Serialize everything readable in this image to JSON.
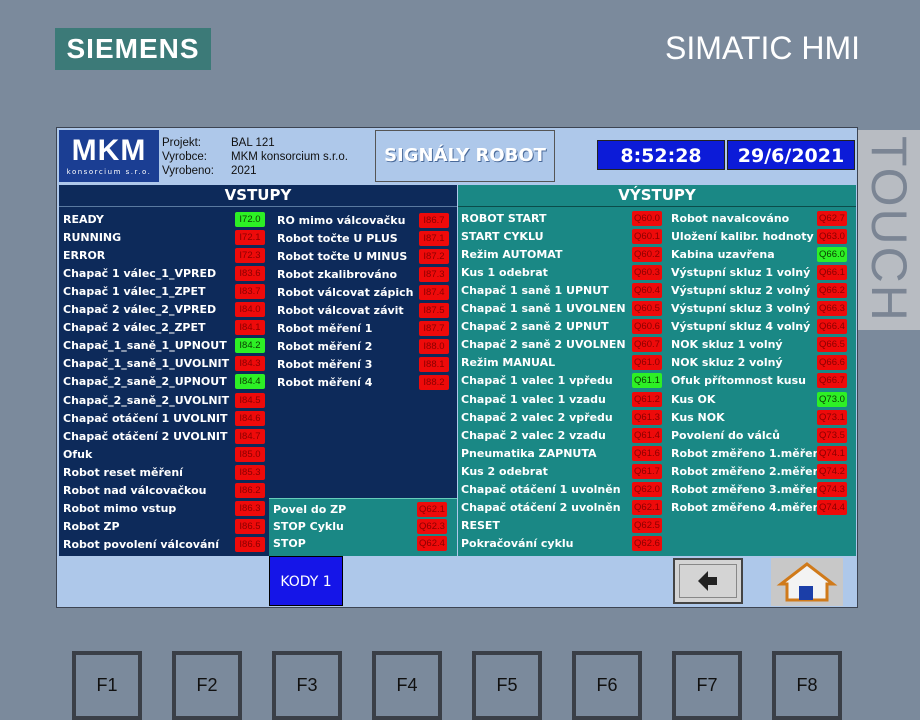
{
  "brand": "SIEMENS",
  "model": "SIMATIC HMI",
  "touch": "TOUCH",
  "header": {
    "logo_big": "MKM",
    "logo_small": "konsorcium s.r.o.",
    "project_key": "Projekt:",
    "project_val": "BAL 121",
    "maker_key": "Vyrobce:",
    "maker_val": "MKM konsorcium s.r.o.",
    "year_key": "Vyrobeno:",
    "year_val": "2021",
    "title": "SIGNÁLY ROBOT",
    "time": "8:52:28",
    "date": "29/6/2021"
  },
  "inputs": {
    "title": "VSTUPY",
    "col1": [
      {
        "label": "READY",
        "code": "I72.0",
        "on": true
      },
      {
        "label": "RUNNING",
        "code": "I72.1",
        "on": false
      },
      {
        "label": "ERROR",
        "code": "I72.3",
        "on": false
      },
      {
        "label": "Chapač 1 válec_1_VPRED",
        "code": "I83.6",
        "on": false
      },
      {
        "label": "Chapač 1 válec_1_ZPET",
        "code": "I83.7",
        "on": false
      },
      {
        "label": "Chapač 2 válec_2_VPRED",
        "code": "I84.0",
        "on": false
      },
      {
        "label": "Chapač 2 válec_2_ZPET",
        "code": "I84.1",
        "on": false
      },
      {
        "label": "Chapač_1_saně_1_UPNOUT",
        "code": "I84.2",
        "on": true
      },
      {
        "label": "Chapač_1_saně_1_UVOLNIT",
        "code": "I84.3",
        "on": false
      },
      {
        "label": "Chapač_2_saně_2_UPNOUT",
        "code": "I84.4",
        "on": true
      },
      {
        "label": "Chapač_2_saně_2_UVOLNIT",
        "code": "I84.5",
        "on": false
      },
      {
        "label": "Chapač otáčení 1 UVOLNIT",
        "code": "I84.6",
        "on": false
      },
      {
        "label": "Chapač otáčení 2 UVOLNIT",
        "code": "I84.7",
        "on": false
      },
      {
        "label": "Ofuk",
        "code": "I85.0",
        "on": false
      },
      {
        "label": "Robot reset měření",
        "code": "I85.3",
        "on": false
      },
      {
        "label": "Robot nad válcovačkou",
        "code": "I86.2",
        "on": false
      },
      {
        "label": "Robot mimo vstup",
        "code": "I86.3",
        "on": false
      },
      {
        "label": "Robot ZP",
        "code": "I86.5",
        "on": false
      },
      {
        "label": "Robot povolení válcování",
        "code": "I86.6",
        "on": false
      }
    ],
    "col2": [
      {
        "label": "RO mimo válcovačku",
        "code": "I86.7",
        "on": false
      },
      {
        "label": "Robot točte U PLUS",
        "code": "I87.1",
        "on": false
      },
      {
        "label": "Robot točte U MINUS",
        "code": "I87.2",
        "on": false
      },
      {
        "label": "Robot zkalibrováno",
        "code": "I87.3",
        "on": false
      },
      {
        "label": "Robot válcovat zápich",
        "code": "I87.4",
        "on": false
      },
      {
        "label": "Robot válcovat závit",
        "code": "I87.5",
        "on": false
      },
      {
        "label": "Robot měření 1",
        "code": "I87.7",
        "on": false
      },
      {
        "label": "Robot měření 2",
        "code": "I88.0",
        "on": false
      },
      {
        "label": "Robot měření 3",
        "code": "I88.1",
        "on": false
      },
      {
        "label": "Robot měření 4",
        "code": "I88.2",
        "on": false
      }
    ],
    "col2_bottom": [
      {
        "label": "Povel do ZP",
        "code": "Q62.1",
        "on": false
      },
      {
        "label": "STOP Cyklu",
        "code": "Q62.3",
        "on": false
      },
      {
        "label": "STOP",
        "code": "Q62.4",
        "on": false
      }
    ]
  },
  "outputs": {
    "title": "VÝSTUPY",
    "col1": [
      {
        "label": "ROBOT START",
        "code": "Q60.0",
        "on": false
      },
      {
        "label": "START CYKLU",
        "code": "Q60.1",
        "on": false
      },
      {
        "label": "Režim AUTOMAT",
        "code": "Q60.2",
        "on": false
      },
      {
        "label": "Kus 1 odebrat",
        "code": "Q60.3",
        "on": false
      },
      {
        "label": "Chapač 1 saně 1 UPNUT",
        "code": "Q60.4",
        "on": false
      },
      {
        "label": "Chapač 1 saně 1 UVOLNEN",
        "code": "Q60.5",
        "on": false
      },
      {
        "label": "Chapač 2 saně 2  UPNUT",
        "code": "Q60.6",
        "on": false
      },
      {
        "label": "Chapač 2 saně 2  UVOLNEN",
        "code": "Q60.7",
        "on": false
      },
      {
        "label": "Režim MANUAL",
        "code": "Q61.0",
        "on": false
      },
      {
        "label": "Chapač 1 valec 1 vpředu",
        "code": "Q61.1",
        "on": true
      },
      {
        "label": "Chapač 1 valec 1 vzadu",
        "code": "Q61.2",
        "on": false
      },
      {
        "label": "Chapač 2 valec 2 vpředu",
        "code": "Q61.3",
        "on": false
      },
      {
        "label": "Chapač 2 valec 2 vzadu",
        "code": "Q61.4",
        "on": false
      },
      {
        "label": "Pneumatika ZAPNUTA",
        "code": "Q61.6",
        "on": false
      },
      {
        "label": "Kus 2 odebrat",
        "code": "Q61.7",
        "on": false
      },
      {
        "label": "Chapač otáčení 1 uvolněn",
        "code": "Q62.0",
        "on": false
      },
      {
        "label": "Chapač otáčení 2 uvolněn",
        "code": "Q62.1",
        "on": false
      },
      {
        "label": "RESET",
        "code": "Q62.5",
        "on": false
      },
      {
        "label": "Pokračování cyklu",
        "code": "Q62.6",
        "on": false
      }
    ],
    "col2": [
      {
        "label": "Robot navalcováno",
        "code": "Q62.7",
        "on": false
      },
      {
        "label": "Uložení kalibr. hodnoty",
        "code": "Q63.0",
        "on": false
      },
      {
        "label": "Kabina uzavřena",
        "code": "Q66.0",
        "on": true
      },
      {
        "label": "Výstupní skluz 1 volný",
        "code": "Q66.1",
        "on": false
      },
      {
        "label": "Výstupní skluz 2 volný",
        "code": "Q66.2",
        "on": false
      },
      {
        "label": "Výstupní skluz 3 volný",
        "code": "Q66.3",
        "on": false
      },
      {
        "label": "Výstupní skluz 4 volný",
        "code": "Q66.4",
        "on": false
      },
      {
        "label": "NOK skluz 1 volný",
        "code": "Q66.5",
        "on": false
      },
      {
        "label": "NOK skluz 2 volný",
        "code": "Q66.6",
        "on": false
      },
      {
        "label": "Ofuk přítomnost kusu",
        "code": "Q66.7",
        "on": false
      },
      {
        "label": "Kus OK",
        "code": "Q73.0",
        "on": true
      },
      {
        "label": "Kus NOK",
        "code": "Q73.1",
        "on": false
      },
      {
        "label": "Povolení do válců",
        "code": "Q73.5",
        "on": false
      },
      {
        "label": "Robot změřeno 1.měření",
        "code": "Q74.1",
        "on": false
      },
      {
        "label": "Robot změřeno 2.měření",
        "code": "Q74.2",
        "on": false
      },
      {
        "label": "Robot změřeno 3.měření",
        "code": "Q74.3",
        "on": false
      },
      {
        "label": "Robot změřeno 4.měření",
        "code": "Q74.4",
        "on": false
      }
    ]
  },
  "footer": {
    "kody_label": "KODY 1",
    "back_icon": "arrow-left-icon",
    "home_icon": "home-icon"
  },
  "fkeys": [
    "F1",
    "F2",
    "F3",
    "F4",
    "F5",
    "F6",
    "F7",
    "F8"
  ],
  "colors": {
    "on": "#2df025",
    "off": "#ee0a0a",
    "inputs_bg": "#0d2a5a",
    "outputs_bg": "#1a8885",
    "accent": "#1515e8"
  }
}
